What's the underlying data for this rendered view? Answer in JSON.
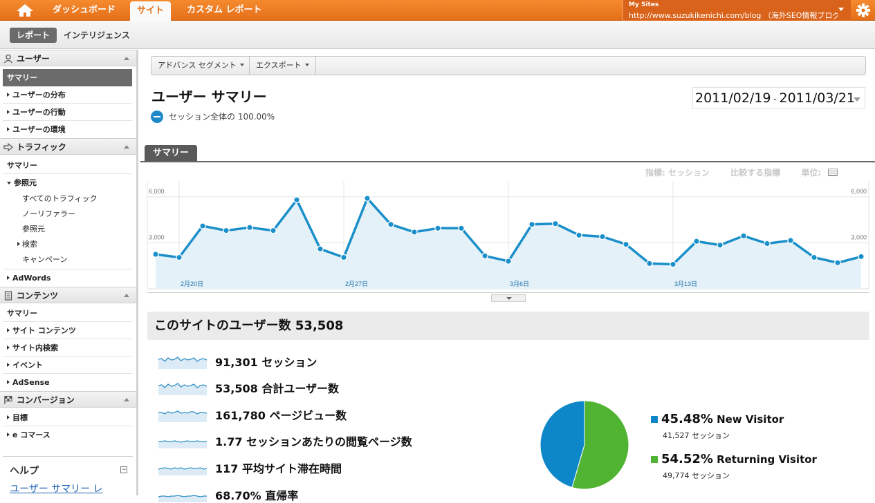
{
  "topbar": {
    "tabs": [
      {
        "label": "ダッシュボード"
      },
      {
        "label": "サイト"
      },
      {
        "label": "カスタム レポート"
      }
    ],
    "my_sites_label": "My Sites",
    "site_url": "http://www.suzukikenichi.com/blog （海外SEO情報ブログ",
    "icons": {
      "home": "home-icon",
      "settings": "gear-icon"
    }
  },
  "subnav": {
    "report_label": "レポート",
    "intelligence_label": "インテリジェンス"
  },
  "sidebar": {
    "sections": [
      {
        "title": "ユーザー",
        "icon": "user-icon"
      },
      {
        "title": "トラフィック",
        "icon": "traffic-arrow-icon"
      },
      {
        "title": "コンテンツ",
        "icon": "document-icon"
      },
      {
        "title": "コンバージョン",
        "icon": "flag-icon"
      }
    ],
    "users_items": [
      "サマリー",
      "ユーザーの分布",
      "ユーザーの行動",
      "ユーザーの環境"
    ],
    "traffic_items": [
      "サマリー",
      "参照元"
    ],
    "traffic_sub": [
      "すべてのトラフィック",
      "ノーリファラー",
      "参照元",
      "検索",
      "キャンペーン"
    ],
    "adwords": "AdWords",
    "content_items": [
      "サマリー",
      "サイト コンテンツ",
      "サイト内検索",
      "イベント",
      "AdSense"
    ],
    "conversion_items": [
      "目標",
      "e コマース"
    ],
    "help_title": "ヘルプ",
    "help_link": "ユーザー サマリー レ"
  },
  "toolbar": {
    "segment_label": "アドバンス セグメント",
    "export_label": "エクスポート"
  },
  "page": {
    "title": "ユーザー サマリー",
    "segment_text": "セッション全体の 100.00%",
    "date_start": "2011/02/19",
    "date_sep": " - ",
    "date_end": "2011/03/21",
    "summary_tab": "サマリー",
    "metric_label": "指標: セッション",
    "compare_label": "比較する指標",
    "unit_label": "単位:"
  },
  "chart_data": {
    "type": "area",
    "x": [
      "2/19",
      "2/20",
      "2/21",
      "2/22",
      "2/23",
      "2/24",
      "2/25",
      "2/26",
      "2/27",
      "2/28",
      "3/1",
      "3/2",
      "3/3",
      "3/4",
      "3/5",
      "3/6",
      "3/7",
      "3/8",
      "3/9",
      "3/10",
      "3/11",
      "3/12",
      "3/13",
      "3/14",
      "3/15",
      "3/16",
      "3/17",
      "3/18",
      "3/19",
      "3/20",
      "3/21"
    ],
    "y": [
      2250,
      2050,
      4100,
      3800,
      4000,
      3800,
      5800,
      2600,
      2050,
      5900,
      4200,
      3700,
      3950,
      3950,
      2150,
      1800,
      4200,
      4250,
      3500,
      3400,
      2900,
      1650,
      1600,
      3100,
      2850,
      3450,
      2950,
      3150,
      2050,
      1700,
      2100
    ],
    "ylim": [
      0,
      7300
    ],
    "y_ticks": [
      {
        "value": 3000,
        "label": "3,000"
      },
      {
        "value": 6000,
        "label": "6,000"
      }
    ],
    "x_ticks": [
      {
        "index": 1,
        "label": "2月20日"
      },
      {
        "index": 8,
        "label": "2月27日"
      },
      {
        "index": 15,
        "label": "3月6日"
      },
      {
        "index": 22,
        "label": "3月13日"
      }
    ],
    "line_color": "#1a8fc9",
    "fill_color": "#e5f1f8",
    "grid": true
  },
  "users": {
    "heading": "このサイトのユーザー数 53,508",
    "stats": [
      {
        "text": "91,301 セッション",
        "spark": "sparkline-icon"
      },
      {
        "text": "53,508 合計ユーザー数",
        "spark": "sparkline-icon"
      },
      {
        "text": "161,780 ページビュー数",
        "spark": "sparkline-icon"
      },
      {
        "text": "1.77 セッションあたりの閲覧ページ数",
        "spark": "sparkline-icon"
      },
      {
        "text": "117 平均サイト滞在時間",
        "spark": "sparkline-icon"
      },
      {
        "text": "68.70% 直帰率",
        "spark": "sparkline-icon"
      }
    ]
  },
  "visitors_pie": {
    "type": "pie",
    "slices": [
      {
        "pct": "45.48%",
        "value": 45.48,
        "name": "New Visitor",
        "sessions": "41,527 セッション",
        "color": "#0e87c9"
      },
      {
        "pct": "54.52%",
        "value": 54.52,
        "name": "Returning Visitor",
        "sessions": "49,774 セッション",
        "color": "#50b432"
      }
    ]
  }
}
